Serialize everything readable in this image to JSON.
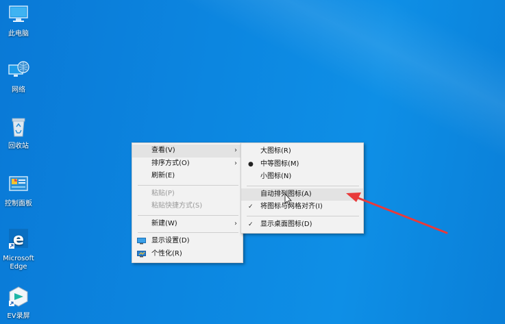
{
  "desktop": {
    "icons": [
      {
        "label": "此电脑",
        "icon": "this-pc-icon"
      },
      {
        "label": "网络",
        "icon": "network-icon"
      },
      {
        "label": "回收站",
        "icon": "recycle-bin-icon"
      },
      {
        "label": "控制面板",
        "icon": "control-panel-icon"
      },
      {
        "label": "Microsoft Edge",
        "icon": "edge-icon"
      },
      {
        "label": "EV录屏",
        "icon": "ev-recorder-icon"
      }
    ]
  },
  "context_menu": {
    "items": [
      {
        "label": "查看(V)",
        "has_submenu": true,
        "highlighted": true
      },
      {
        "label": "排序方式(O)",
        "has_submenu": true
      },
      {
        "label": "刷新(E)"
      },
      {
        "label": "粘贴(P)",
        "disabled": true
      },
      {
        "label": "粘贴快捷方式(S)",
        "disabled": true
      },
      {
        "label": "新建(W)",
        "has_submenu": true
      },
      {
        "label": "显示设置(D)",
        "icon": "display-settings-icon"
      },
      {
        "label": "个性化(R)",
        "icon": "personalize-icon"
      }
    ]
  },
  "view_submenu": {
    "items": [
      {
        "label": "大图标(R)"
      },
      {
        "label": "中等图标(M)",
        "selected": true
      },
      {
        "label": "小图标(N)"
      },
      {
        "label": "自动排列图标(A)",
        "highlighted": true
      },
      {
        "label": "将图标与网格对齐(I)",
        "checked": true
      },
      {
        "label": "显示桌面图标(D)",
        "checked": true
      }
    ]
  },
  "annotation": {
    "color": "#e83a3a"
  }
}
